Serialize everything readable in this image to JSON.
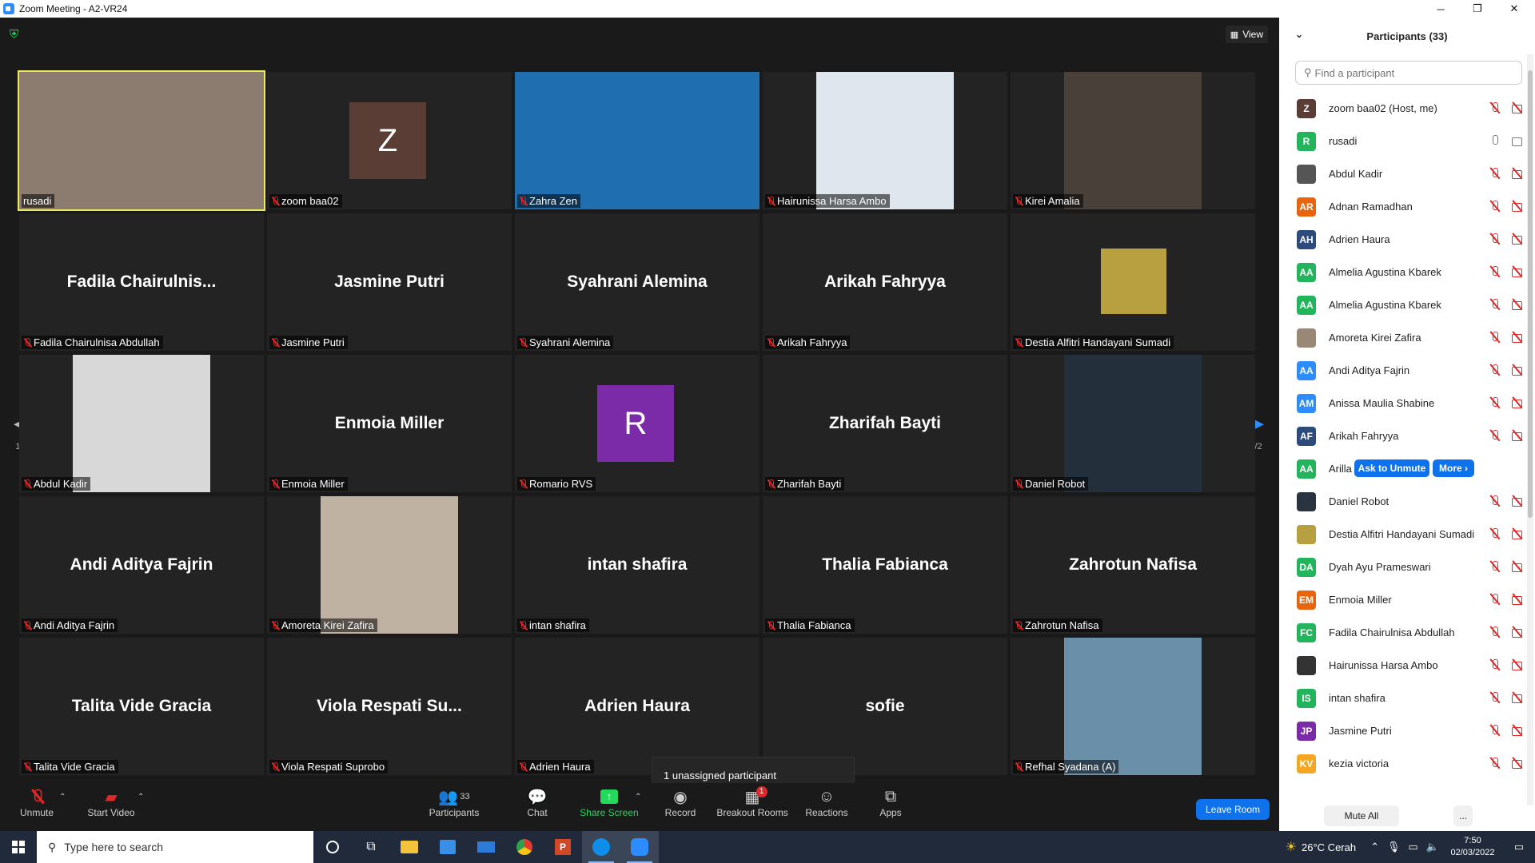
{
  "window": {
    "title": "Zoom Meeting - A2-VR24",
    "minimize": "─",
    "maximize": "❐",
    "close": "✕"
  },
  "meeting": {
    "view_label": "View",
    "page_left": "1/2",
    "page_right": "1/2",
    "tooltip": "1 unassigned participant",
    "tiles": [
      {
        "label": "rusadi",
        "kind": "video",
        "bg": "#8c7c70",
        "muted": false,
        "active": true
      },
      {
        "label": "zoom baa02",
        "kind": "avatar",
        "letter": "Z",
        "avatar_color": "#5a3e36",
        "muted": true
      },
      {
        "label": "Zahra Zen",
        "kind": "video",
        "bg": "#1f6fb0",
        "muted": true
      },
      {
        "label": "Hairunissa Harsa Ambo",
        "kind": "photo",
        "bg": "#dfe6ee",
        "muted": true
      },
      {
        "label": "Kirei Amalia",
        "kind": "photo",
        "bg": "#4a403a",
        "muted": true
      },
      {
        "label": "Fadila Chairulnisa Abdullah",
        "kind": "name",
        "display": "Fadila  Chairulnis...",
        "muted": true
      },
      {
        "label": "Jasmine Putri",
        "kind": "name",
        "display": "Jasmine Putri",
        "muted": true
      },
      {
        "label": "Syahrani Alemina",
        "kind": "name",
        "display": "Syahrani Alemina",
        "muted": true
      },
      {
        "label": "Arikah Fahryya",
        "kind": "name",
        "display": "Arikah Fahryya",
        "muted": true
      },
      {
        "label": "Destia Alfitri Handayani Sumadi",
        "kind": "smallphoto",
        "bg": "#b8a040",
        "muted": true
      },
      {
        "label": "Abdul Kadir",
        "kind": "photo",
        "bg": "#d8d8d8",
        "muted": true
      },
      {
        "label": "Enmoia Miller",
        "kind": "name",
        "display": "Enmoia Miller",
        "muted": true
      },
      {
        "label": "Romario RVS",
        "kind": "avatar",
        "letter": "R",
        "avatar_color": "#7b2aa8",
        "muted": true
      },
      {
        "label": "Zharifah Bayti",
        "kind": "name",
        "display": "Zharifah Bayti",
        "muted": true
      },
      {
        "label": "Daniel Robot",
        "kind": "photo",
        "bg": "#23303c",
        "muted": true
      },
      {
        "label": "Andi Aditya Fajrin",
        "kind": "name",
        "display": "Andi Aditya Fajrin",
        "muted": true
      },
      {
        "label": "Amoreta Kirei Zafira",
        "kind": "photo",
        "bg": "#bfb2a2",
        "muted": true
      },
      {
        "label": "intan shafira",
        "kind": "name",
        "display": "intan shafira",
        "muted": true
      },
      {
        "label": "Thalia Fabianca",
        "kind": "name",
        "display": "Thalia Fabianca",
        "muted": true
      },
      {
        "label": "Zahrotun Nafisa",
        "kind": "name",
        "display": "Zahrotun Nafisa",
        "muted": true
      },
      {
        "label": "Talita Vide Gracia",
        "kind": "name",
        "display": "Talita Vide Gracia",
        "muted": true
      },
      {
        "label": "Viola Respati Suprobo",
        "kind": "name",
        "display": "Viola  Respati  Su...",
        "muted": true
      },
      {
        "label": "Adrien Haura",
        "kind": "name",
        "display": "Adrien Haura",
        "muted": true
      },
      {
        "label": "",
        "kind": "name",
        "display": "sofie",
        "muted": false
      },
      {
        "label": "Refhal Syadana (A)",
        "kind": "photo",
        "bg": "#6a8fa8",
        "muted": true
      }
    ]
  },
  "toolbar": {
    "unmute": "Unmute",
    "start_video": "Start Video",
    "participants": "Participants",
    "participants_count": "33",
    "chat": "Chat",
    "share_screen": "Share Screen",
    "record": "Record",
    "breakout_rooms": "Breakout Rooms",
    "breakout_badge": "1",
    "reactions": "Reactions",
    "apps": "Apps",
    "leave_room": "Leave Room"
  },
  "panel": {
    "title": "Participants (33)",
    "search_placeholder": "Find a participant",
    "mute_all": "Mute All",
    "more_footer": "...",
    "ask_to_unmute": "Ask to Unmute",
    "more": "More ›",
    "participants": [
      {
        "initials": "Z",
        "color": "#5a3e36",
        "name": "zoom baa02 (Host, me)",
        "muted": true,
        "video": false
      },
      {
        "initials": "R",
        "color": "#23b55c",
        "name": "rusadi",
        "muted": false,
        "video": true
      },
      {
        "initials": "",
        "color": "#555555",
        "name": "Abdul Kadir",
        "muted": true,
        "video": false,
        "photo": true
      },
      {
        "initials": "AR",
        "color": "#e8650e",
        "name": "Adnan Ramadhan",
        "muted": true,
        "video": false
      },
      {
        "initials": "AH",
        "color": "#2c4a7a",
        "name": "Adrien Haura",
        "muted": true,
        "video": false
      },
      {
        "initials": "AA",
        "color": "#23b55c",
        "name": "Almelia Agustina Kbarek",
        "muted": true,
        "video": false
      },
      {
        "initials": "AA",
        "color": "#23b55c",
        "name": "Almelia Agustina Kbarek",
        "muted": true,
        "video": false
      },
      {
        "initials": "",
        "color": "#9a8876",
        "name": "Amoreta Kirei Zafira",
        "muted": true,
        "video": false,
        "photo": true
      },
      {
        "initials": "AA",
        "color": "#2d8cff",
        "name": "Andi Aditya Fajrin",
        "muted": true,
        "video": false
      },
      {
        "initials": "AM",
        "color": "#2d8cff",
        "name": "Anissa Maulia Shabine",
        "muted": true,
        "video": false
      },
      {
        "initials": "AF",
        "color": "#2c4a7a",
        "name": "Arikah Fahryya",
        "muted": true,
        "video": false
      },
      {
        "initials": "AA",
        "color": "#23b55c",
        "name": "Arilla ...",
        "muted": true,
        "video": false,
        "hover": true
      },
      {
        "initials": "",
        "color": "#2a3440",
        "name": "Daniel Robot",
        "muted": true,
        "video": false,
        "photo": true
      },
      {
        "initials": "",
        "color": "#b8a040",
        "name": "Destia Alfitri Handayani Sumadi",
        "muted": true,
        "video": false,
        "photo": true
      },
      {
        "initials": "DA",
        "color": "#23b55c",
        "name": "Dyah Ayu Prameswari",
        "muted": true,
        "video": false
      },
      {
        "initials": "EM",
        "color": "#e8650e",
        "name": "Enmoia Miller",
        "muted": true,
        "video": false
      },
      {
        "initials": "FC",
        "color": "#23b55c",
        "name": "Fadila Chairulnisa Abdullah",
        "muted": true,
        "video": false
      },
      {
        "initials": "",
        "color": "#333333",
        "name": "Hairunissa Harsa Ambo",
        "muted": true,
        "video": false,
        "photo": true
      },
      {
        "initials": "IS",
        "color": "#23b55c",
        "name": "intan shafira",
        "muted": true,
        "video": false
      },
      {
        "initials": "JP",
        "color": "#7b2aa8",
        "name": "Jasmine Putri",
        "muted": true,
        "video": false
      },
      {
        "initials": "KV",
        "color": "#f5a623",
        "name": "kezia victoria",
        "muted": true,
        "video": false
      }
    ]
  },
  "taskbar": {
    "search_placeholder": "Type here to search",
    "weather": "26°C  Cerah",
    "time": "7:50",
    "date": "02/03/2022"
  }
}
